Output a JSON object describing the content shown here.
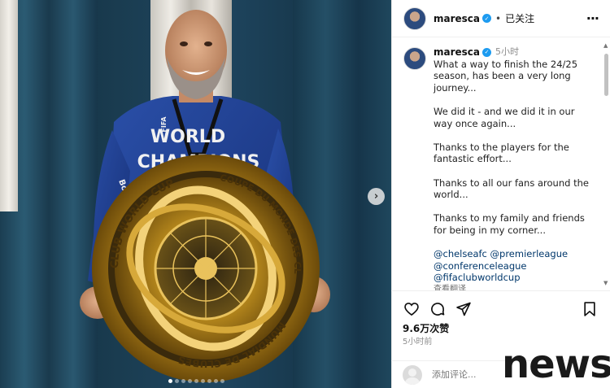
{
  "post": {
    "username": "maresca",
    "follow_state": "已关注",
    "separator": "•",
    "time_ago": "5小时",
    "caption_paragraphs": [
      "What a way to finish the 24/25 season, has been a very long journey...",
      "We did it - and we did it in our way once again...",
      "Thanks to the players for the fantastic effort...",
      "Thanks to all our fans around the world...",
      "Thanks to my family and friends for being in my corner..."
    ],
    "tags": [
      "@chelseafc @premierleague",
      "@conferenceleague",
      "@fifaclubworldcup"
    ],
    "see_translation": "查看翻译",
    "likes": "9.6万次赞",
    "posted_time": "5小时前",
    "comment_placeholder": "添加评论..."
  },
  "photo": {
    "jersey_text_1": "WORLD",
    "jersey_text_2": "CHAMPIONS",
    "jersey_logo": "FIFA",
    "trophy_text_left": "CLUB WORLD CUP",
    "trophy_text_right": "COUPE DU MONDE DES CLUBS",
    "trophy_text_bottom": "MUNDIAL DE CLUBES",
    "sleeve_sponsor": "Bow"
  },
  "carousel": {
    "dot_count": 9,
    "active_index": 0,
    "next_icon": "›"
  },
  "watermark": "news",
  "icons": {
    "more": "more-horizontal-icon",
    "like": "heart-icon",
    "comment": "comment-icon",
    "share": "send-icon",
    "save": "bookmark-icon"
  },
  "colors": {
    "verified": "#1d9bf0",
    "link": "#00376b",
    "muted": "#8e8e8e"
  }
}
